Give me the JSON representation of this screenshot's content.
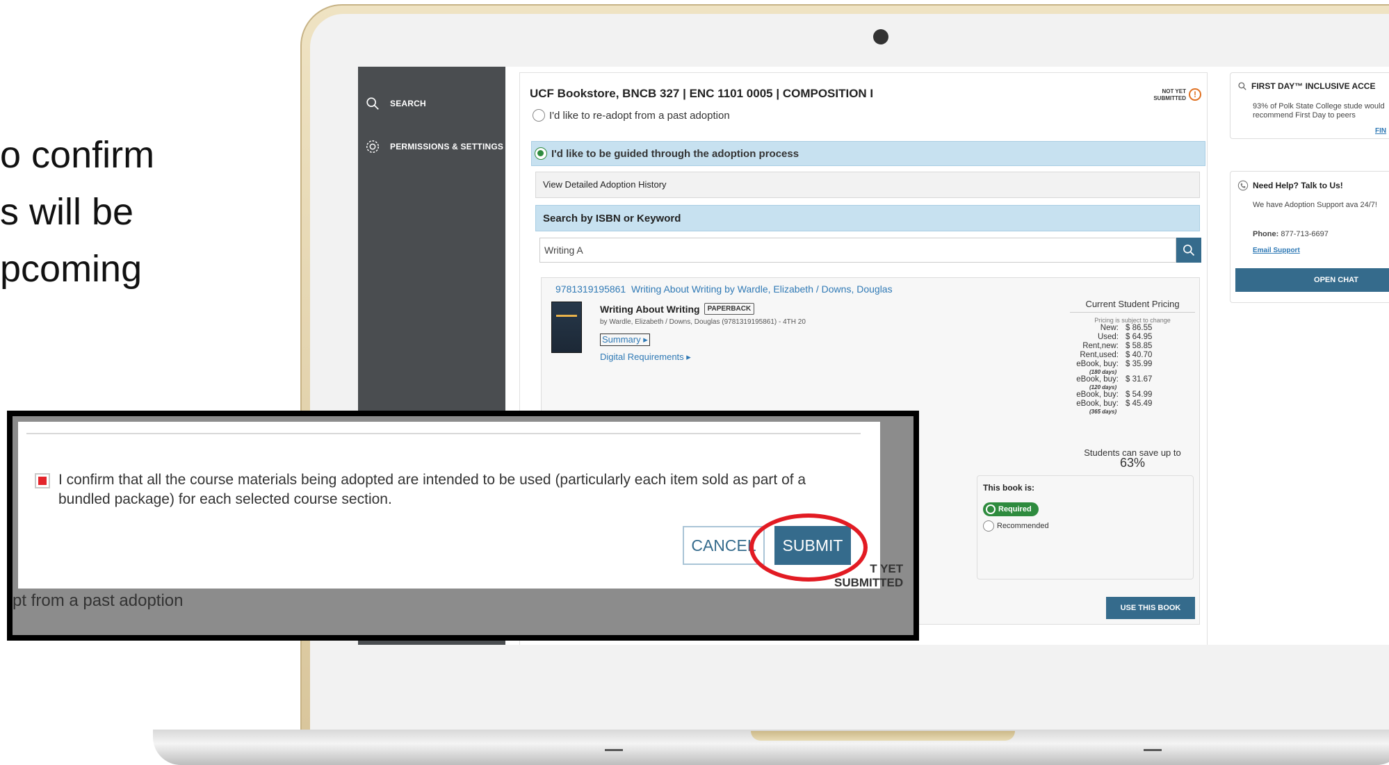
{
  "slide": {
    "lines": [
      "o confirm",
      "s will be",
      "pcoming"
    ]
  },
  "sidebar": {
    "items": [
      {
        "label": "SEARCH",
        "icon": "search-icon"
      },
      {
        "label": "PERMISSIONS & SETTINGS",
        "icon": "gear-icon"
      }
    ]
  },
  "main": {
    "title": "UCF Bookstore, BNCB 327 | ENC 1101 0005 | COMPOSITION I",
    "status_line1": "NOT YET",
    "status_line2": "SUBMITTED",
    "status_icon": "!",
    "option_readopt": "I'd like to re-adopt from a past adoption",
    "option_guided": "I'd like to be guided through the adoption process",
    "history_label": "View Detailed Adoption History",
    "search_heading": "Search by ISBN or Keyword",
    "search_value": "Writing A",
    "result": {
      "isbn": "9781319195861",
      "heading_title": "Writing About Writing by Wardle, Elizabeth / Downs, Douglas",
      "title": "Writing About Writing",
      "format": "PAPERBACK",
      "byline": "by Wardle, Elizabeth / Downs, Douglas (9781319195861) - 4TH 20",
      "summary_label": "Summary",
      "digital_label": "Digital Requirements",
      "pricing_title": "Current Student Pricing",
      "pricing_note": "Pricing is subject to change",
      "prices": [
        {
          "label": "New:",
          "value": "$ 86.55",
          "sub": ""
        },
        {
          "label": "Used:",
          "value": "$ 64.95",
          "sub": ""
        },
        {
          "label": "Rent,new:",
          "value": "$ 58.85",
          "sub": ""
        },
        {
          "label": "Rent,used:",
          "value": "$ 40.70",
          "sub": ""
        },
        {
          "label": "eBook, buy:",
          "value": "$ 35.99",
          "sub": "(180 days)"
        },
        {
          "label": "eBook, buy:",
          "value": "$ 31.67",
          "sub": "(120 days)"
        },
        {
          "label": "eBook, buy:",
          "value": "$ 54.99",
          "sub": ""
        },
        {
          "label": "eBook, buy:",
          "value": "$ 45.49",
          "sub": "(365 days)"
        }
      ],
      "save_text": "Students can save up to",
      "save_pct": "63%",
      "bookis_title": "This book is:",
      "required_label": "Required",
      "recommended_label": "Recommended",
      "use_button": "USE THIS BOOK"
    }
  },
  "right": {
    "card1_title": "FIRST DAY™ INCLUSIVE ACCE",
    "card1_text": "93% of Polk State College stude would recommend First Day to peers",
    "card1_link": "FIN",
    "card2_title": "Need Help? Talk to Us!",
    "card2_text": "We have Adoption Support ava 24/7!",
    "phone_label": "Phone:",
    "phone_value": "877-713-6697",
    "email_label": "Email Support",
    "chat_button": "OPEN CHAT"
  },
  "modal": {
    "confirm_text": "I confirm that all the course materials being adopted are intended to be used (particularly each item sold as part of a bundled package) for each selected course section.",
    "cancel_label": "CANCEL",
    "submit_label": "SUBMIT",
    "bg_status_line1": "T YET",
    "bg_status_line2": "SUBMITTED",
    "bg_text": "pt from a past adoption"
  },
  "colors": {
    "accent": "#356b8c",
    "highlight_blue": "#c7e1f0",
    "sidebar": "#4a4d50",
    "required_green": "#2e8b3e",
    "annotation_red": "#e21b23"
  }
}
